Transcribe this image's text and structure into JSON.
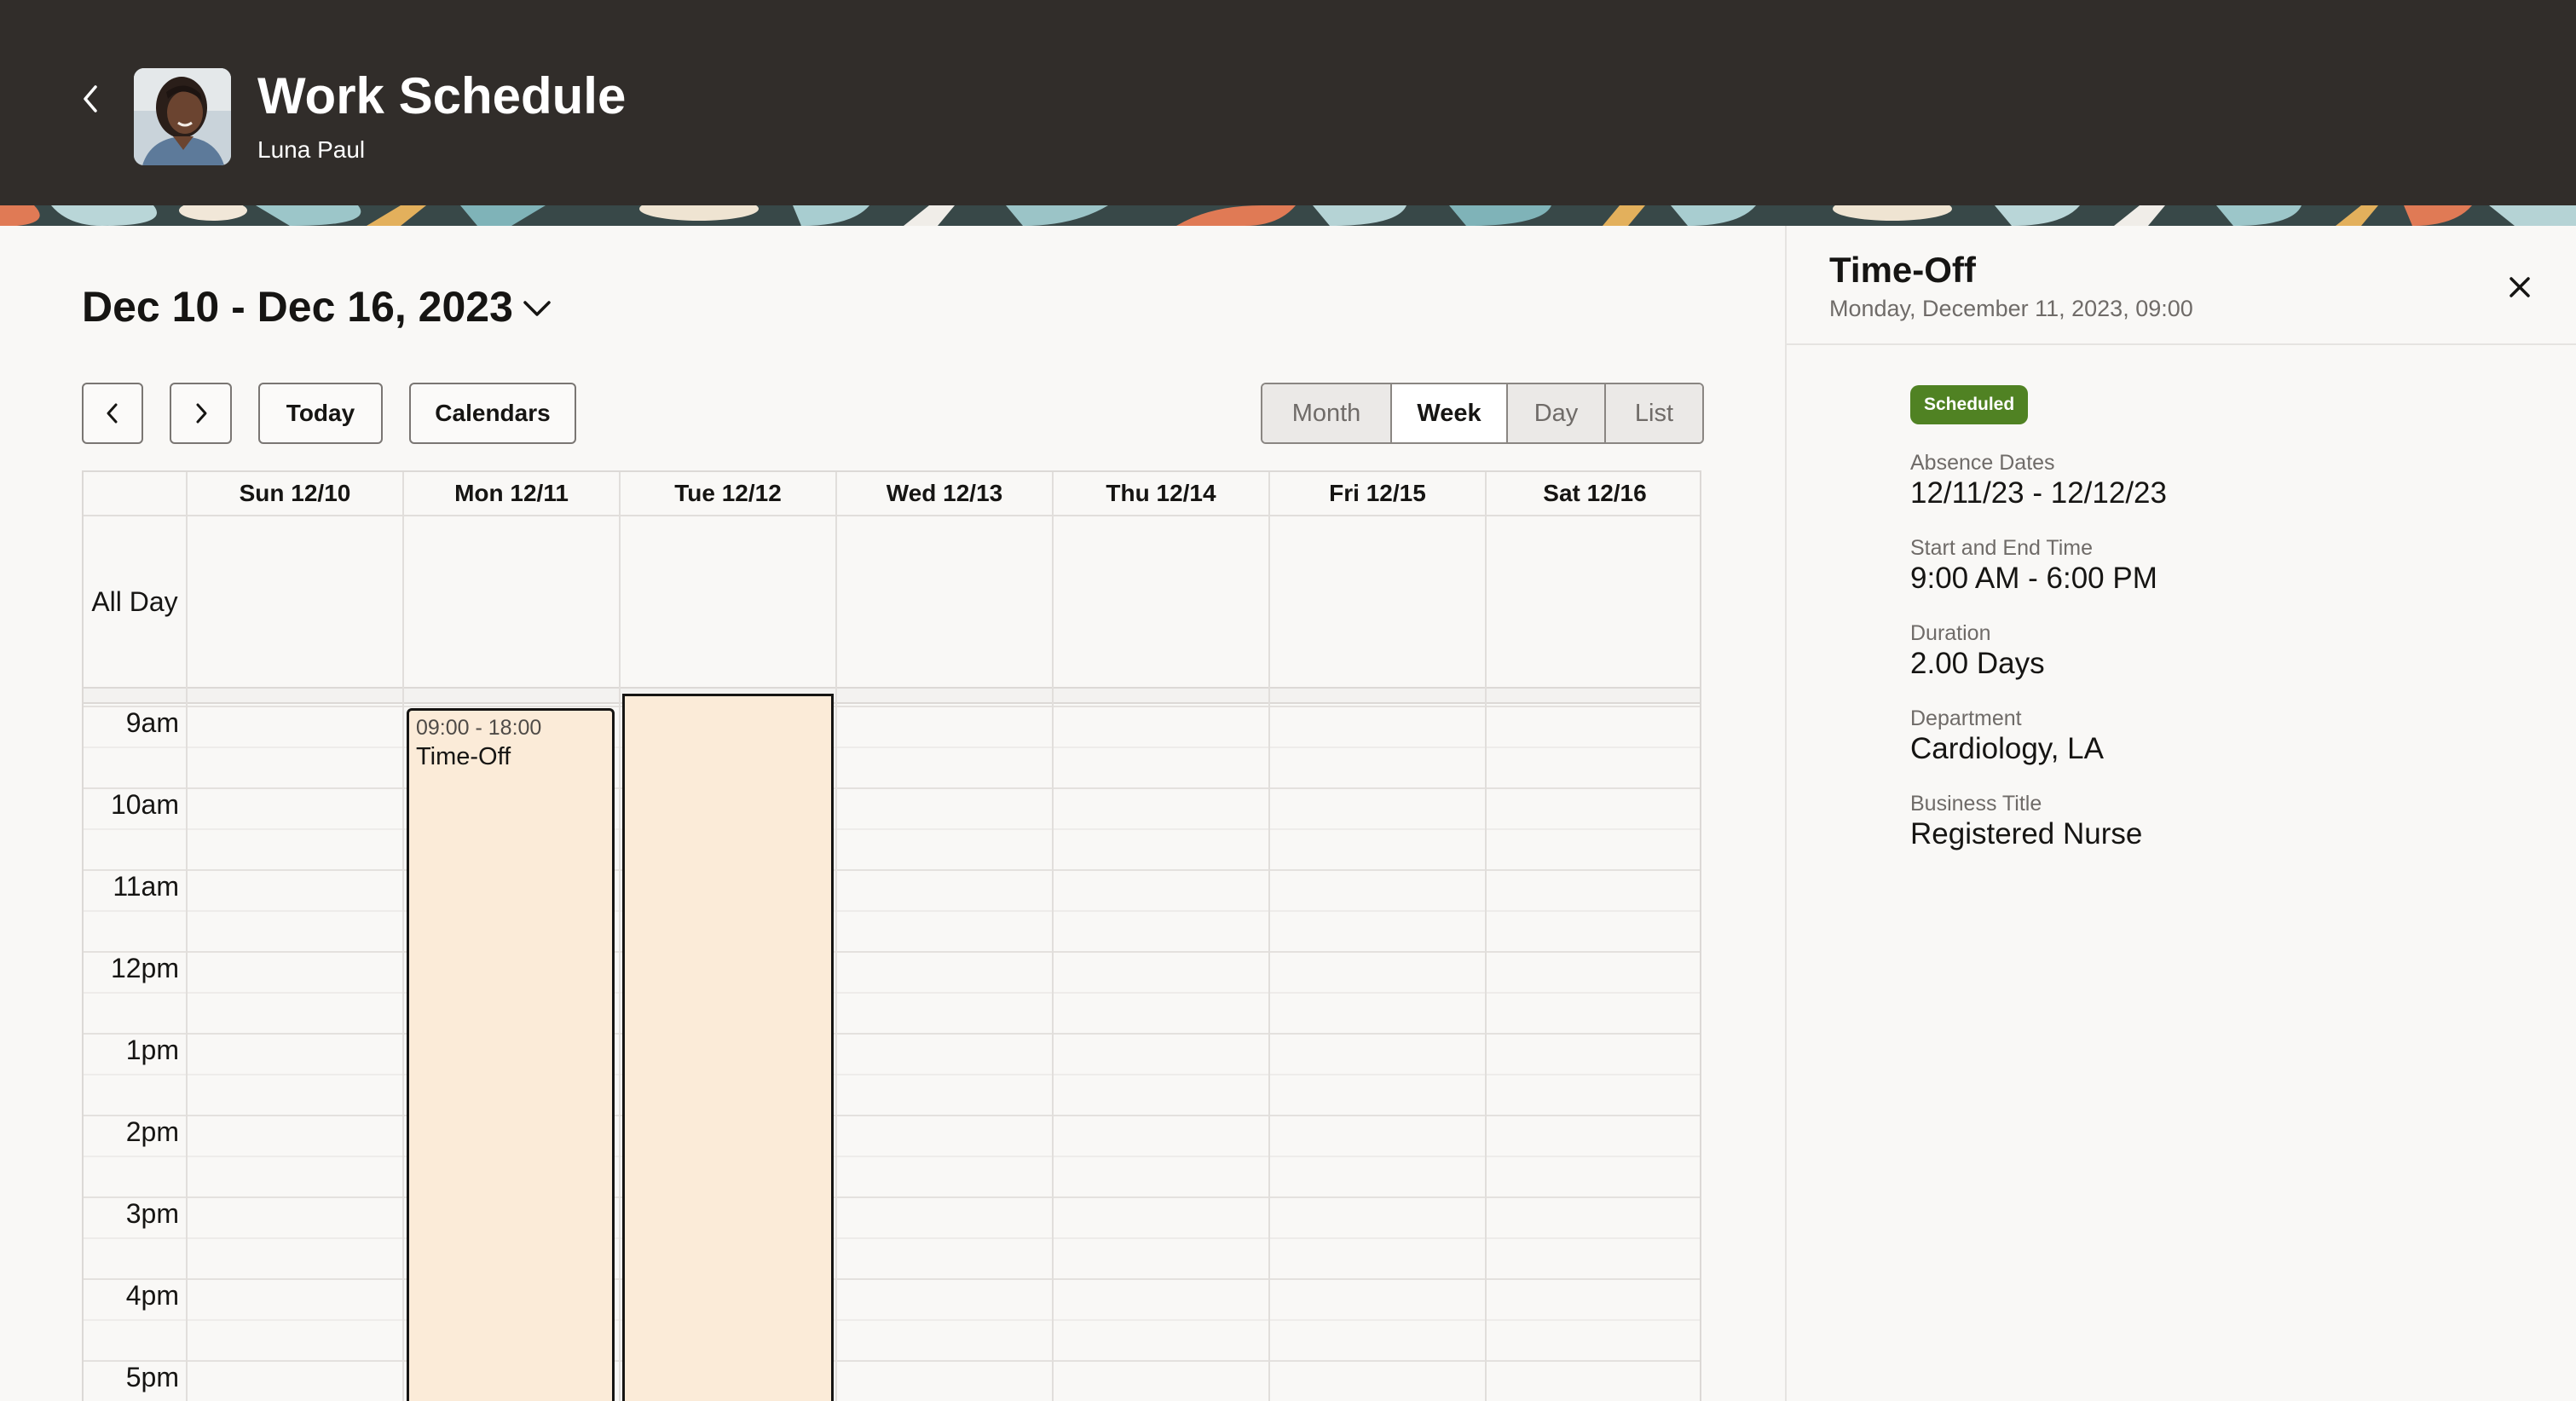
{
  "header": {
    "title": "Work Schedule",
    "subtitle": "Luna Paul",
    "back_icon": "chevron-left-icon",
    "avatar": "person-photo"
  },
  "main": {
    "date_range": "Dec 10 - Dec 16, 2023",
    "range_dropdown_icon": "chevron-down-icon",
    "toolbar": {
      "prev_icon": "chevron-left-icon",
      "next_icon": "chevron-right-icon",
      "today_label": "Today",
      "calendars_label": "Calendars"
    },
    "views": [
      {
        "label": "Month",
        "active": false
      },
      {
        "label": "Week",
        "active": true
      },
      {
        "label": "Day",
        "active": false
      },
      {
        "label": "List",
        "active": false
      }
    ]
  },
  "calendar": {
    "days": [
      "Sun 12/10",
      "Mon 12/11",
      "Tue 12/12",
      "Wed 12/13",
      "Thu 12/14",
      "Fri 12/15",
      "Sat 12/16"
    ],
    "all_day_label": "All Day",
    "hours": [
      "9am",
      "10am",
      "11am",
      "12pm",
      "1pm",
      "2pm",
      "3pm",
      "4pm",
      "5pm"
    ],
    "events": [
      {
        "day": "Mon 12/11",
        "time": "09:00 - 18:00",
        "title": "Time-Off"
      },
      {
        "day": "Tue 12/12",
        "time": "",
        "title": ""
      }
    ],
    "event_color": "#fbebd8"
  },
  "panel": {
    "title": "Time-Off",
    "subtitle": "Monday, December 11, 2023, 09:00",
    "close_icon": "close-icon",
    "status": "Scheduled",
    "status_color": "#508223",
    "fields": [
      {
        "label": "Absence Dates",
        "value": "12/11/23 - 12/12/23"
      },
      {
        "label": "Start and End Time",
        "value": "9:00 AM - 6:00 PM"
      },
      {
        "label": "Duration",
        "value": "2.00 Days"
      },
      {
        "label": "Department",
        "value": "Cardiology, LA"
      },
      {
        "label": "Business Title",
        "value": "Registered Nurse"
      }
    ]
  }
}
